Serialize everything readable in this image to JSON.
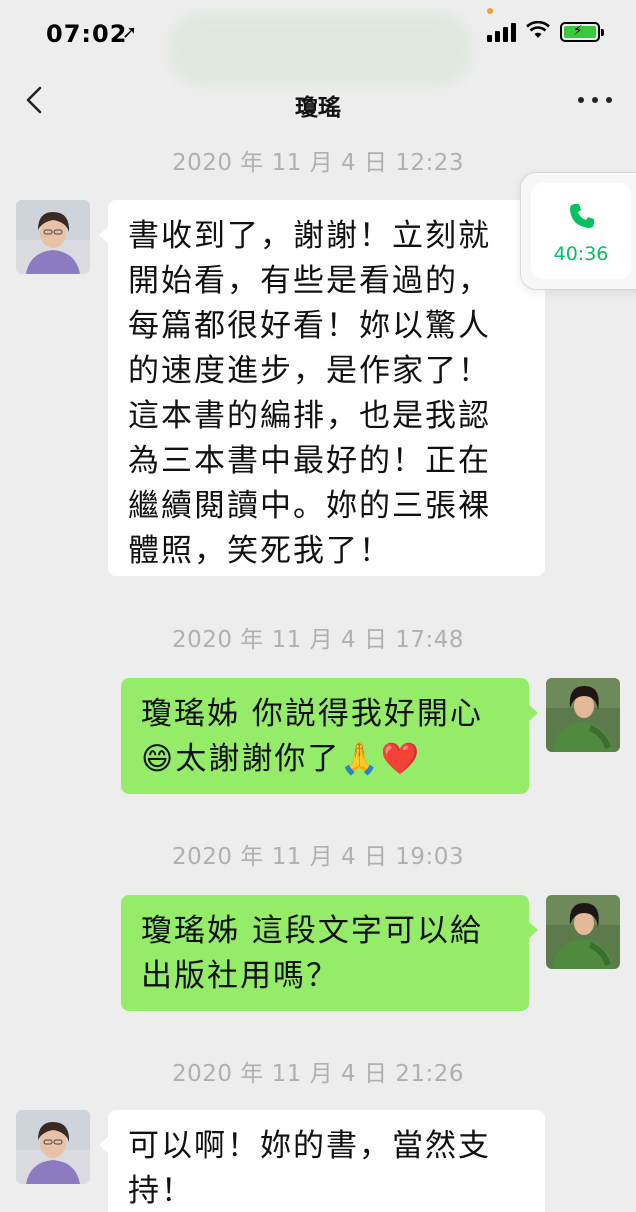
{
  "status_bar": {
    "time": "07:02",
    "location_arrow": "➚"
  },
  "nav": {
    "title": "瓊瑤"
  },
  "call_widget": {
    "duration": "40:36"
  },
  "messages": [
    {
      "timestamp": "2020 年 11 月 4 日 12:23",
      "side": "left",
      "lines": [
        "書收到了，謝謝！立刻就",
        "開始看，有些是看過的，",
        "每篇都很好看！妳以驚人",
        "的速度進步，是作家了！",
        "這本書的編排，也是我認",
        "為三本書中最好的！正在",
        "繼續閱讀中。妳的三張裸",
        "體照，笑死我了！"
      ]
    },
    {
      "timestamp": "2020 年 11 月 4 日 17:48",
      "side": "right",
      "lines": [
        "瓊瑤姊 你説得我好開心",
        "😄太謝謝你了🙏❤️"
      ]
    },
    {
      "timestamp": "2020 年 11 月 4 日 19:03",
      "side": "right",
      "lines": [
        "瓊瑤姊 這段文字可以給",
        "出版社用嗎？"
      ]
    },
    {
      "timestamp": "2020 年 11 月 4 日 21:26",
      "side": "left",
      "lines": [
        "可以啊！妳的書，當然支",
        "持！"
      ]
    }
  ],
  "colors": {
    "background": "#ededed",
    "bubble_self": "#95ec69",
    "bubble_other": "#ffffff",
    "call_green": "#07c160"
  }
}
